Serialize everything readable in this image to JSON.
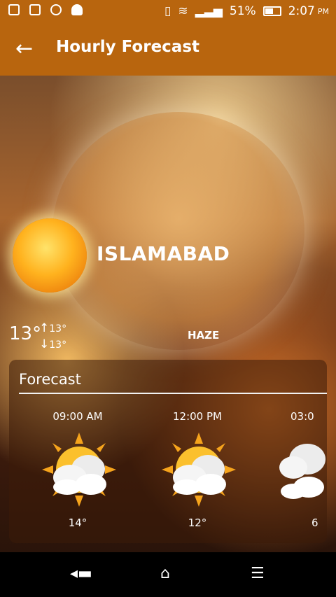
{
  "status_bar": {
    "battery": "51%",
    "time": "2:07",
    "ampm": "PM",
    "icons": [
      "screen-icon",
      "code-icon",
      "usb-icon",
      "android-icon",
      "vibrate-icon",
      "wifi-icon",
      "signal-icon",
      "battery-icon"
    ]
  },
  "appbar": {
    "title": "Hourly Forecast",
    "back_icon": "arrow-left-icon"
  },
  "weather": {
    "city": "ISLAMABAD",
    "temp": "13°",
    "high": "13°",
    "low": "13°",
    "condition": "HAZE"
  },
  "forecast": {
    "title": "Forecast",
    "slots": [
      {
        "time": "09:00 AM",
        "temp": "14°",
        "icon": "partly-cloudy-icon"
      },
      {
        "time": "12:00 PM",
        "temp": "12°",
        "icon": "partly-cloudy-icon"
      },
      {
        "time": "03:0",
        "temp": "6",
        "icon": "cloudy-icon"
      }
    ]
  },
  "nav": {
    "back": "back-nav-icon",
    "home": "home-nav-icon",
    "recent": "recents-nav-icon"
  },
  "colors": {
    "appbar": "#b8650e",
    "card": "#3c1c0a",
    "sun": "#ffb21e"
  }
}
